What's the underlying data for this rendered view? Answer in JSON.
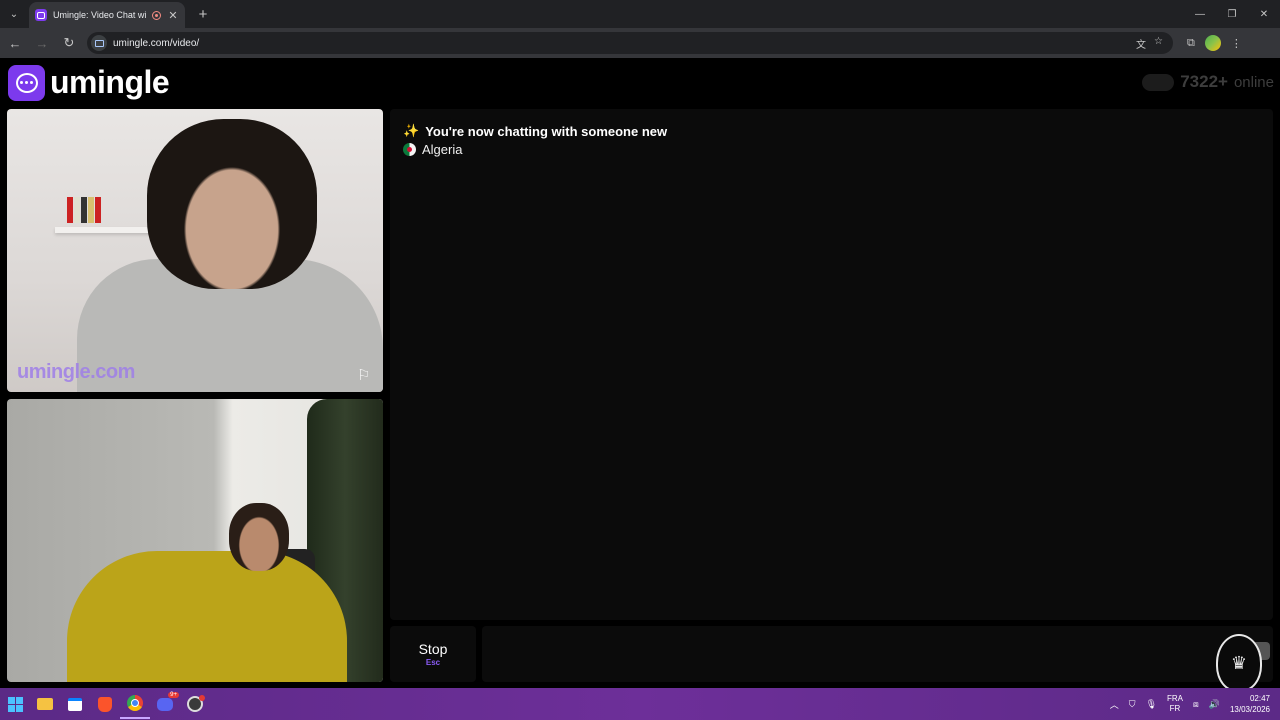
{
  "browser": {
    "tab_title": "Umingle: Video Chat with S",
    "tab_close": "✕",
    "new_tab": "+",
    "url": "umingle.com/video/",
    "window_buttons": [
      "—",
      "❐",
      "✕"
    ]
  },
  "site": {
    "logo_text": "umingle",
    "online_count": "7322+",
    "online_label": "online"
  },
  "videos": {
    "stranger_watermark": "umingle.com",
    "report_icon": "flag-icon"
  },
  "chat": {
    "status_message": "You're now chatting with someone new",
    "country": "Algeria",
    "country_flag": "algeria-flag-icon"
  },
  "controls": {
    "stop_label": "Stop",
    "stop_shortcut": "Esc"
  },
  "taskbar": {
    "discord_badge": "9+",
    "language_top": "FRA",
    "language_bottom": "FR",
    "time": "02:47",
    "date": "13/03/2026"
  },
  "colors": {
    "brand": "#7c3aed",
    "taskbar": "#6d2f99",
    "chat_panel": "#0b0b0b"
  }
}
